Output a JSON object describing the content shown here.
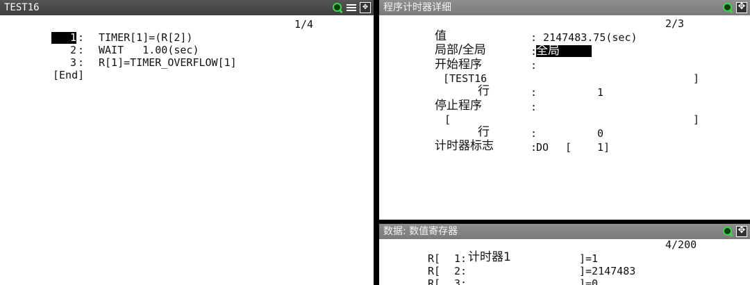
{
  "left": {
    "title": "TEST16",
    "page": "1/4",
    "lines": [
      {
        "num": "1",
        "sep": ":",
        "code": "TIMER[1]=(R[2])"
      },
      {
        "num": "2",
        "sep": ":",
        "code": "WAIT   1.00(sec)"
      },
      {
        "num": "3",
        "sep": ":",
        "code": "R[1]=TIMER_OVERFLOW[1]"
      }
    ],
    "end": "[End]"
  },
  "detail": {
    "title": "程序计时器详细",
    "page": "2/3",
    "value_label": "值",
    "value": ": 2147483.75(sec)",
    "scope_label": "局部/全局",
    "scope_colon": ":",
    "scope_value": "全局",
    "start_label": "开始程序",
    "start_colon": ":",
    "start_prog": "[TEST16",
    "start_close": "]",
    "start_line_label": "行",
    "start_line_colon": ":",
    "start_line_value": "1",
    "stop_label": "停止程序",
    "stop_colon": ":",
    "stop_prog": "[",
    "stop_close": "]",
    "stop_line_label": "行",
    "stop_line_colon": ":",
    "stop_line_value": "0",
    "flag_label": "计时器标志",
    "flag_colon": ":",
    "flag_io": "DO",
    "flag_open": "[",
    "flag_index": "1]"
  },
  "registers": {
    "title": "数据: 数值寄存器",
    "page": "4/200",
    "rows": [
      {
        "prefix": "R[",
        "index": "1:",
        "comment": "计时器1",
        "value": "]=1"
      },
      {
        "prefix": "R[",
        "index": "2:",
        "comment": "",
        "value": "]=2147483"
      },
      {
        "prefix": "R[",
        "index": "3:",
        "comment": "",
        "value": "]=0"
      }
    ]
  }
}
